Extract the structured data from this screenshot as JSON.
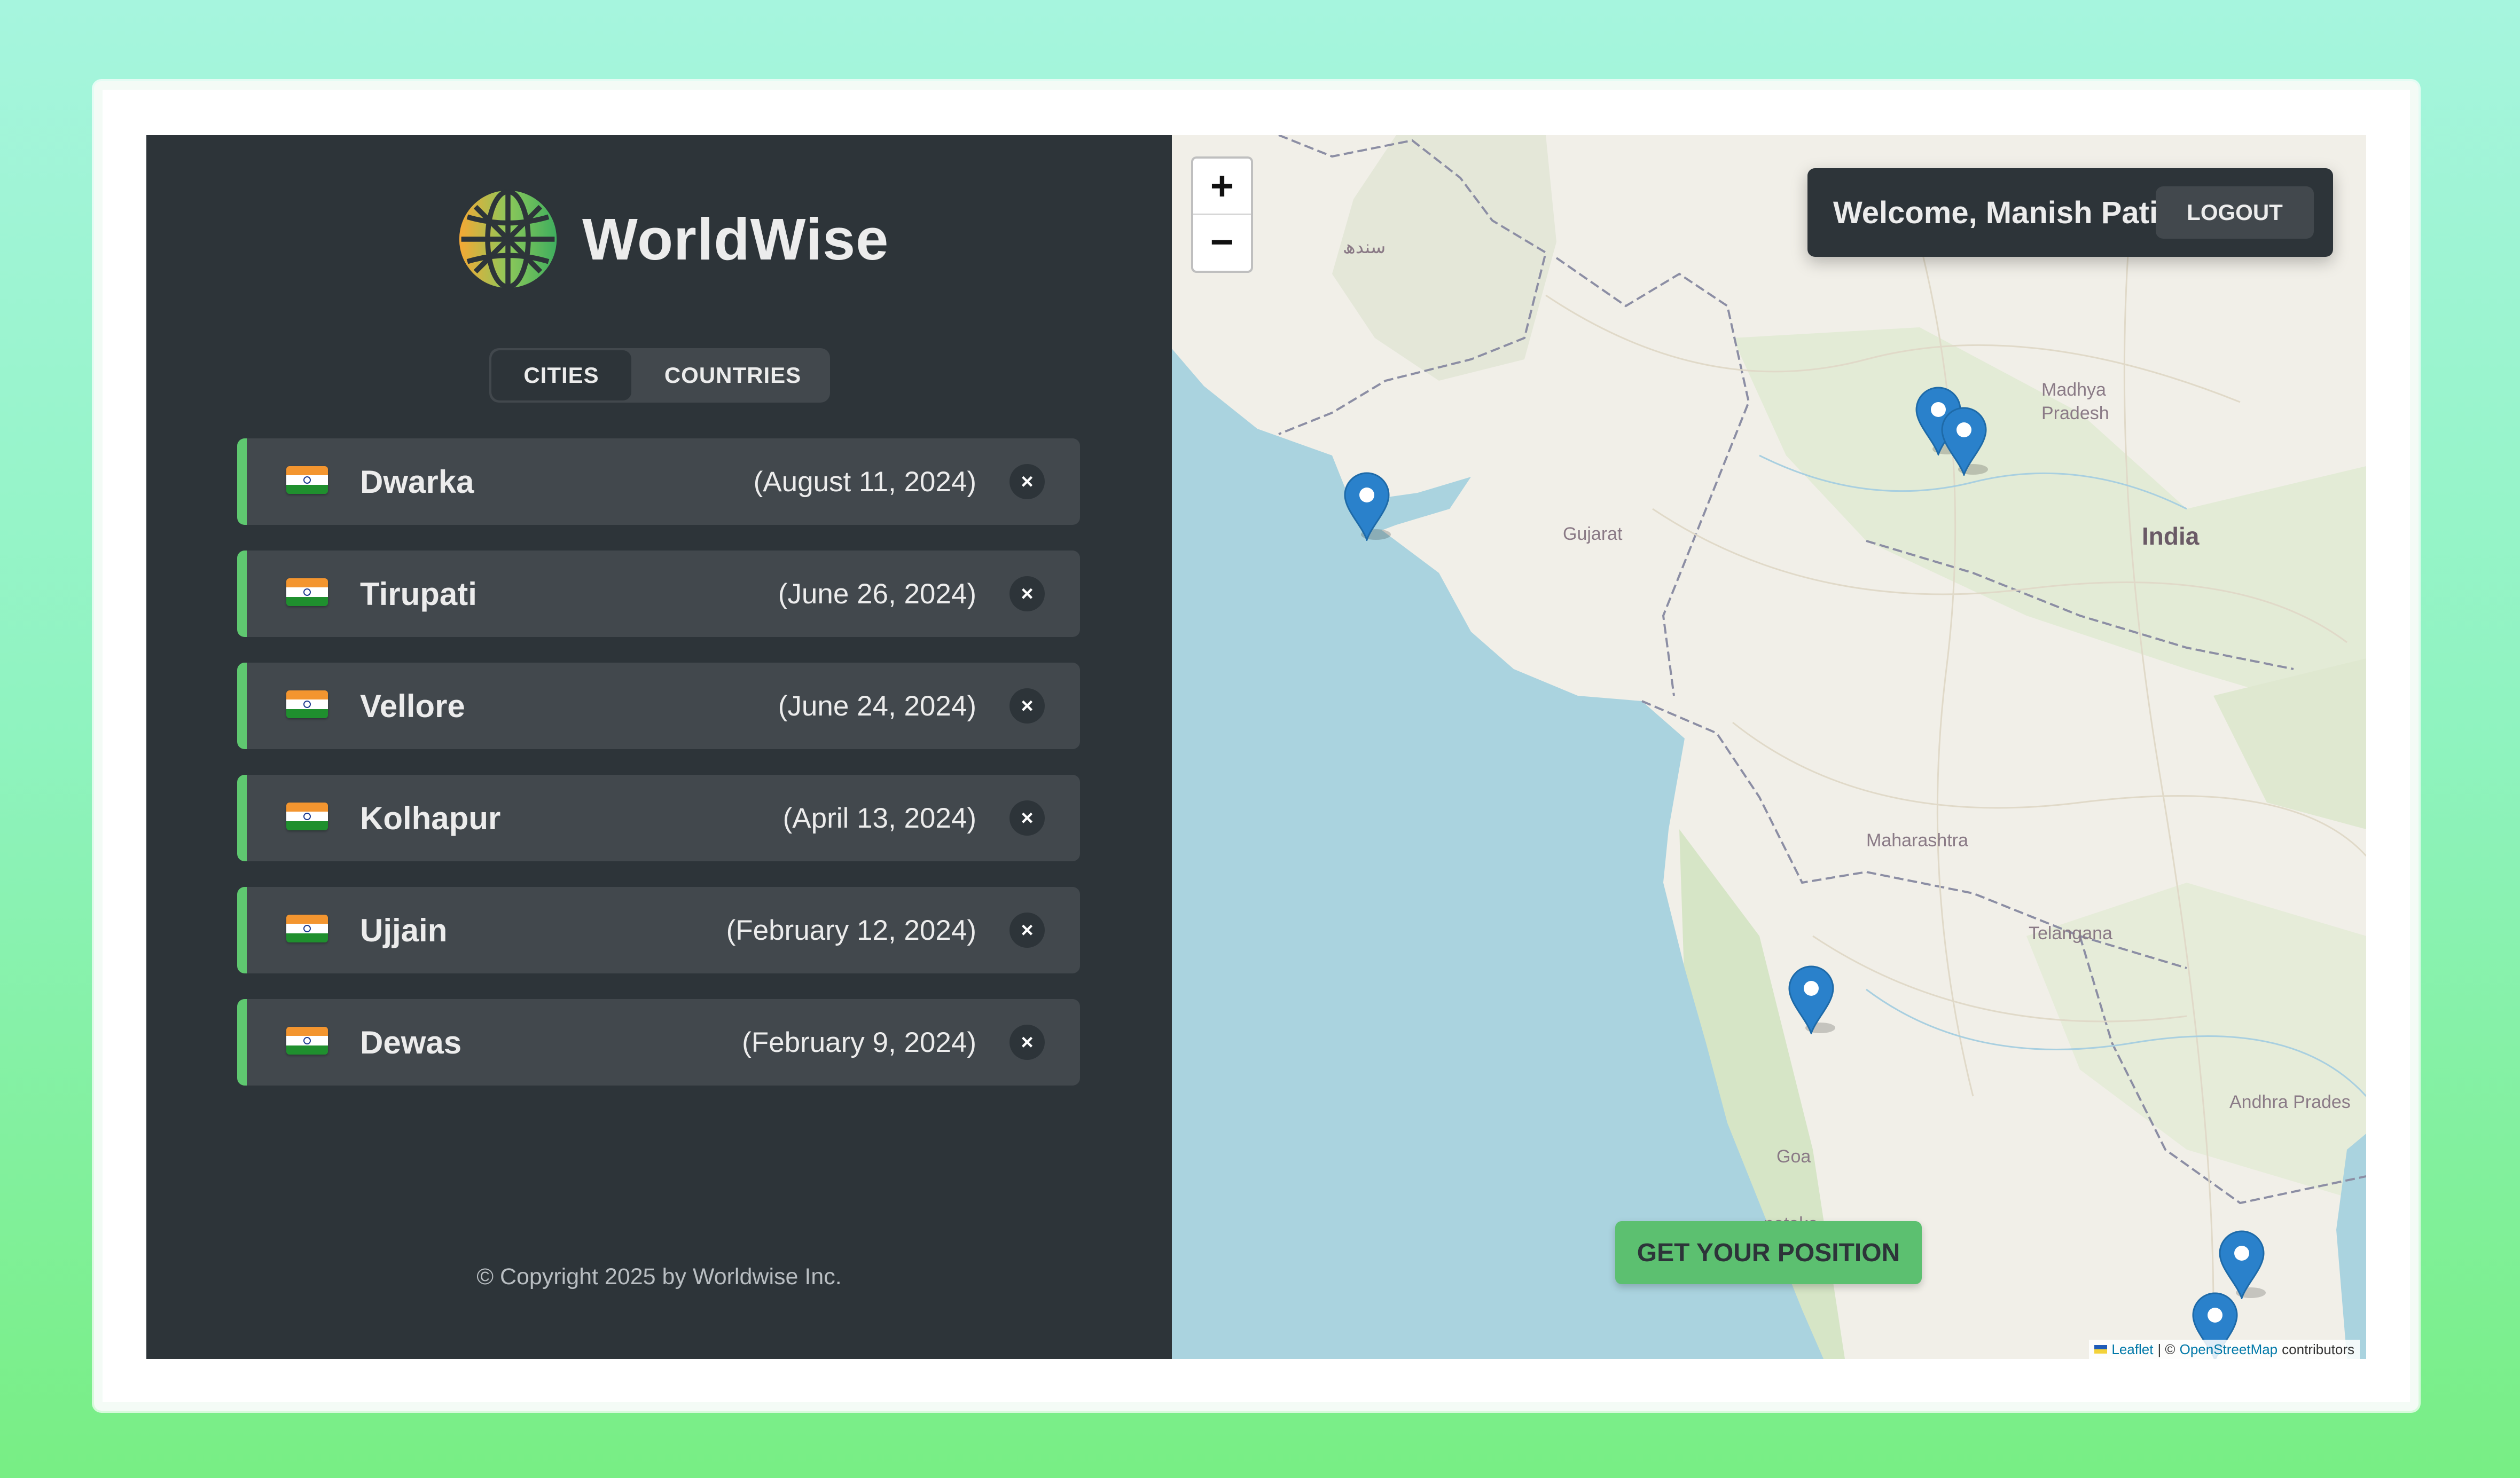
{
  "app": {
    "name": "WorldWise"
  },
  "tabs": [
    {
      "label": "CITIES",
      "active": true
    },
    {
      "label": "COUNTRIES",
      "active": false
    }
  ],
  "cities": [
    {
      "name": "Dwarka",
      "date": "(August 11, 2024)",
      "flag": "india-flag"
    },
    {
      "name": "Tirupati",
      "date": "(June 26, 2024)",
      "flag": "india-flag"
    },
    {
      "name": "Vellore",
      "date": "(June 24, 2024)",
      "flag": "india-flag"
    },
    {
      "name": "Kolhapur",
      "date": "(April 13, 2024)",
      "flag": "india-flag"
    },
    {
      "name": "Ujjain",
      "date": "(February 12, 2024)",
      "flag": "india-flag"
    },
    {
      "name": "Dewas",
      "date": "(February 9, 2024)",
      "flag": "india-flag"
    }
  ],
  "delete_symbol": "×",
  "footer": {
    "copyright": "© Copyright 2025 by Worldwise Inc."
  },
  "map": {
    "zoom_in": "+",
    "zoom_out": "−",
    "geolocation_button": "GET YOUR POSITION",
    "labels": {
      "sindh": "سندھ",
      "gujarat": "Gujarat",
      "madhya_pradesh_1": "Madhya",
      "madhya_pradesh_2": "Pradesh",
      "india": "India",
      "maharashtra": "Maharashtra",
      "telangana": "Telangana",
      "andhra_pradesh": "Andhra Prades",
      "goa": "Goa",
      "karnataka": "nataka"
    },
    "attribution": {
      "leaflet": "Leaflet",
      "separator": "| ©",
      "osm": "OpenStreetMap",
      "contributors": "contributors"
    }
  },
  "user": {
    "welcome": "Welcome, Manish Patil",
    "logout_label": "LOGOUT"
  },
  "colors": {
    "sidebar_bg": "#2d3439",
    "item_bg": "#42484d",
    "accent_green": "#5fc870",
    "sea": "#aad3df",
    "marker_blue": "#2a81cb"
  }
}
